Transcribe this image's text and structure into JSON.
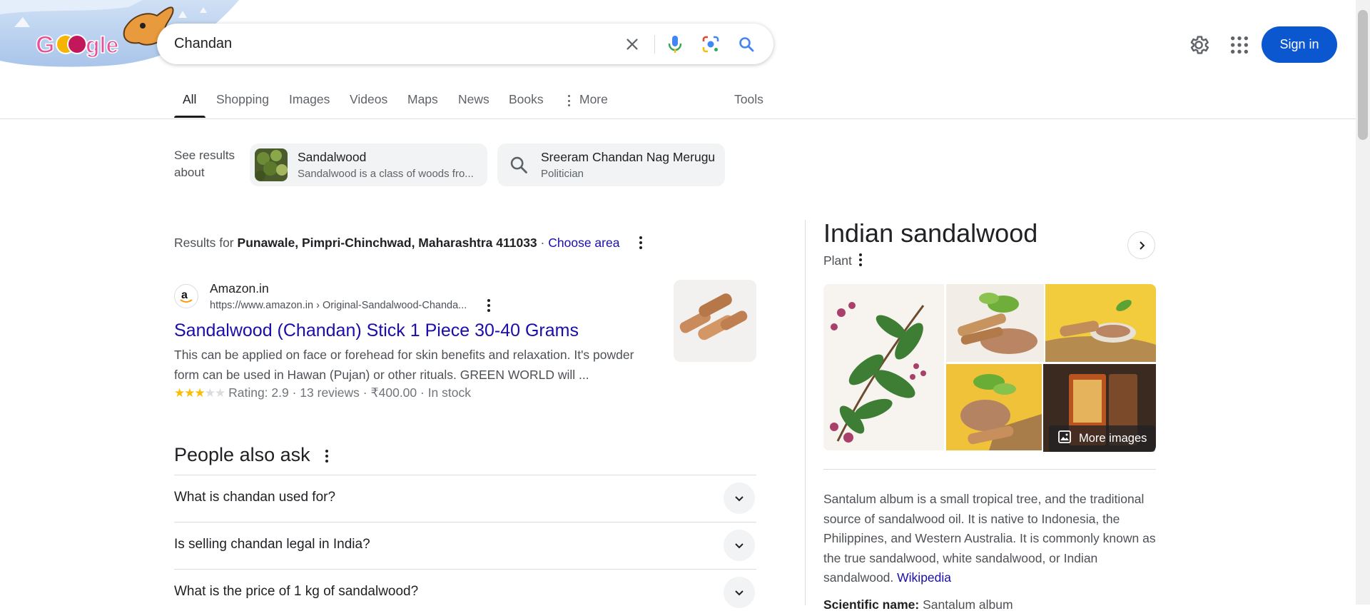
{
  "search": {
    "query": "Chandan"
  },
  "header": {
    "signin_label": "Sign in"
  },
  "tabs": [
    {
      "label": "All",
      "active": true
    },
    {
      "label": "Shopping"
    },
    {
      "label": "Images"
    },
    {
      "label": "Videos"
    },
    {
      "label": "Maps"
    },
    {
      "label": "News"
    },
    {
      "label": "Books"
    },
    {
      "label": "More"
    },
    {
      "label": "Tools"
    }
  ],
  "see_results": {
    "label": "See results about",
    "chips": [
      {
        "title": "Sandalwood",
        "subtitle": "Sandalwood is a class of woods fro..."
      },
      {
        "title": "Sreeram Chandan Nag Merugu",
        "subtitle": "Politician"
      }
    ]
  },
  "results_for": {
    "prefix": "Results for",
    "location": "Punawale, Pimpri-Chinchwad, Maharashtra 411033",
    "separator": "·",
    "choose": "Choose area"
  },
  "result": {
    "site_name": "Amazon.in",
    "url": "https://www.amazon.in › Original-Sandalwood-Chanda...",
    "title": "Sandalwood (Chandan) Stick 1 Piece 30-40 Grams",
    "snippet": "This can be applied on face or forehead for skin benefits and relaxation. It's powder form can be used in Hawan (Pujan) or other rituals. GREEN WORLD will ...",
    "rating_stars": 3,
    "rating_line": "Rating: 2.9 · 13 reviews · ₹400.00 · In stock"
  },
  "paa": {
    "title": "People also ask",
    "questions": [
      "What is chandan used for?",
      "Is selling chandan legal in India?",
      "What is the price of 1 kg of sandalwood?"
    ]
  },
  "knowledge_panel": {
    "title": "Indian sandalwood",
    "subtitle": "Plant",
    "more_images": "More images",
    "description": "Santalum album is a small tropical tree, and the traditional source of sandalwood oil. It is native to Indonesia, the Philippines, and Western Australia. It is commonly known as the true sandalwood, white sandalwood, or Indian sandalwood.",
    "source": "Wikipedia",
    "sci_label": "Scientific name:",
    "sci_value": "Santalum album"
  }
}
